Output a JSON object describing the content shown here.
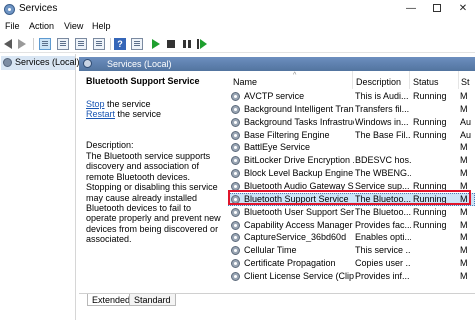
{
  "window": {
    "title": "Services",
    "controls": {
      "minimize": "—",
      "close": "✕"
    }
  },
  "menu": [
    "File",
    "Action",
    "View",
    "Help"
  ],
  "tree": {
    "label": "Services (Local)"
  },
  "header": {
    "label": "Services (Local)"
  },
  "details": {
    "title": "Bluetooth Support Service",
    "stop_link": "Stop",
    "stop_rest": " the service",
    "restart_link": "Restart",
    "restart_rest": " the service",
    "description_label": "Description:",
    "description": "The Bluetooth service supports discovery and association of remote Bluetooth devices.  Stopping or disabling this service may cause already installed Bluetooth devices to fail to operate properly and prevent new devices from being discovered or associated."
  },
  "columns": {
    "name": "Name",
    "description": "Description",
    "status": "Status",
    "startup": "St"
  },
  "rows": [
    {
      "name": "AVCTP service",
      "description": "This is Audi...",
      "status": "Running",
      "startup": "M"
    },
    {
      "name": "Background Intelligent Tran...",
      "description": "Transfers fil...",
      "status": "",
      "startup": "M"
    },
    {
      "name": "Background Tasks Infrastruc...",
      "description": "Windows in...",
      "status": "Running",
      "startup": "Au"
    },
    {
      "name": "Base Filtering Engine",
      "description": "The Base Fil...",
      "status": "Running",
      "startup": "Au"
    },
    {
      "name": "BattlEye Service",
      "description": "",
      "status": "",
      "startup": "M"
    },
    {
      "name": "BitLocker Drive Encryption ...",
      "description": "BDESVC hos...",
      "status": "",
      "startup": "M"
    },
    {
      "name": "Block Level Backup Engine ...",
      "description": "The WBENG...",
      "status": "",
      "startup": "M"
    },
    {
      "name": "Bluetooth Audio Gateway S...",
      "description": "Service sup...",
      "status": "Running",
      "startup": "M"
    },
    {
      "name": "Bluetooth Support Service",
      "description": "The Bluetoo...",
      "status": "Running",
      "startup": "M",
      "selected": true
    },
    {
      "name": "Bluetooth User Support Ser...",
      "description": "The Bluetoo...",
      "status": "Running",
      "startup": "M"
    },
    {
      "name": "Capability Access Manager ...",
      "description": "Provides fac...",
      "status": "Running",
      "startup": "M"
    },
    {
      "name": "CaptureService_36bd60d",
      "description": "Enables opti...",
      "status": "",
      "startup": "M"
    },
    {
      "name": "Cellular Time",
      "description": "This service ...",
      "status": "",
      "startup": "M"
    },
    {
      "name": "Certificate Propagation",
      "description": "Copies user ...",
      "status": "",
      "startup": "M"
    },
    {
      "name": "Client License Service (ClipS...",
      "description": "Provides inf...",
      "status": "",
      "startup": "M"
    }
  ],
  "tabs": [
    "Extended",
    "Standard"
  ]
}
